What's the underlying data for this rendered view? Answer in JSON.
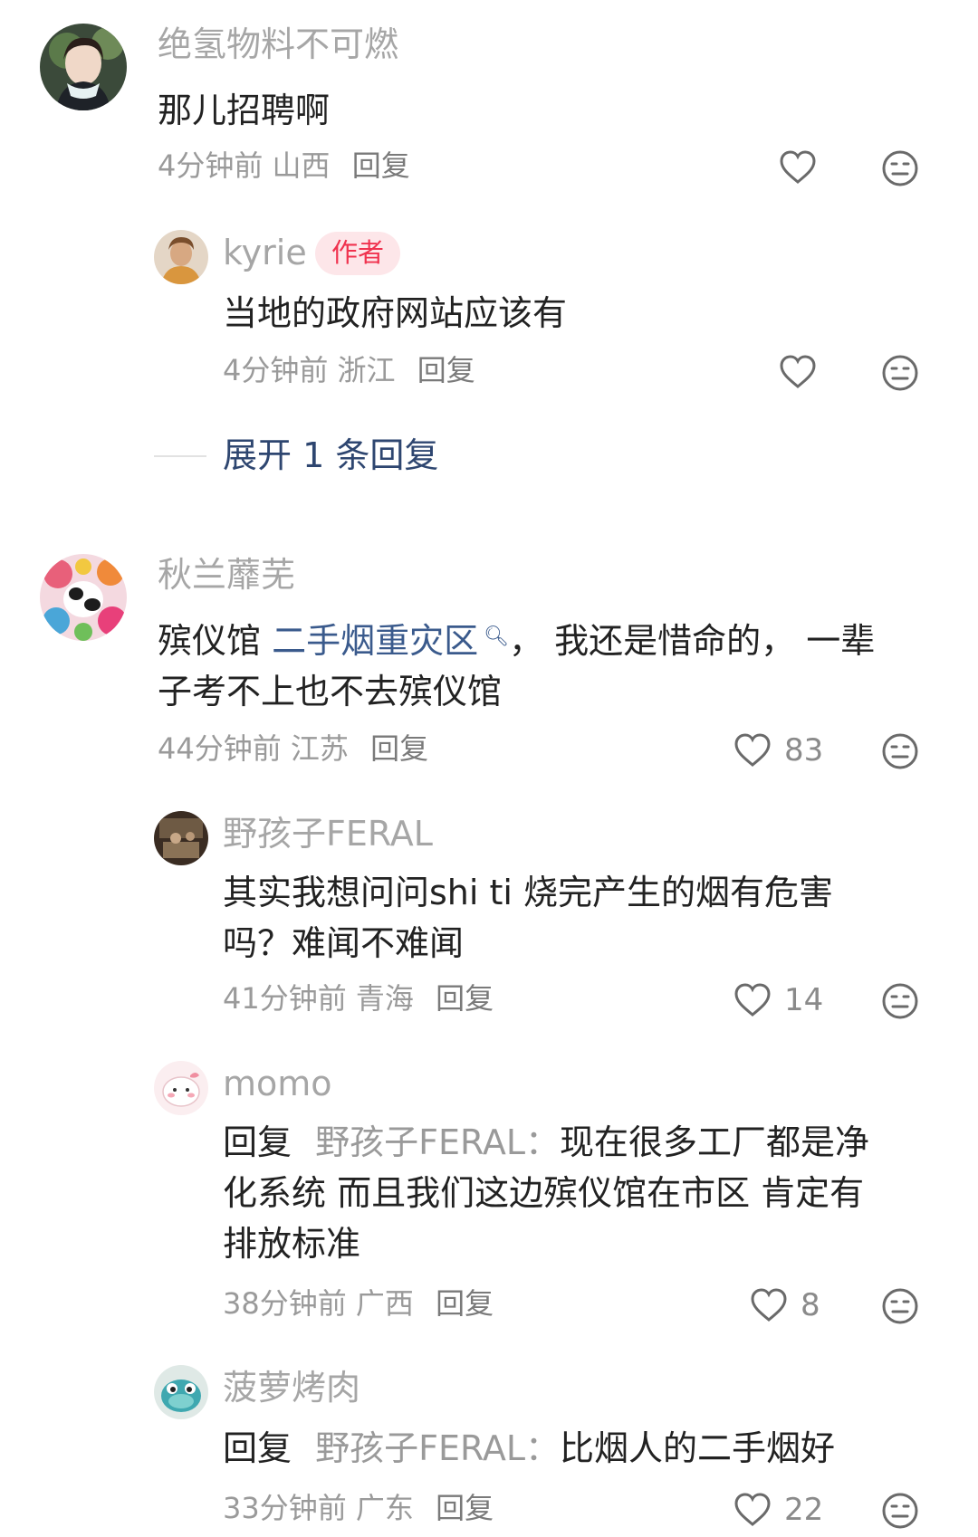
{
  "comments": [
    {
      "user": "绝氢物料不可燃",
      "text": "那儿招聘啊",
      "time": "4分钟前",
      "region": "山西",
      "reply_label": "回复",
      "likes": "",
      "replies": [
        {
          "user": "kyrie",
          "badge": "作者",
          "text": "当地的政府网站应该有",
          "time": "4分钟前",
          "region": "浙江",
          "reply_label": "回复",
          "likes": ""
        }
      ],
      "expand_label": "展开 1 条回复"
    },
    {
      "user": "秋兰蘼芜",
      "text_prefix": "殡仪馆 ",
      "link_text": "二手烟重灾区",
      "text_line1_suffix": "，  我还是惜命的，  一辈",
      "text_line2": "子考不上也不去殡仪馆",
      "time": "44分钟前",
      "region": "江苏",
      "reply_label": "回复",
      "likes": "83",
      "replies": [
        {
          "user": "野孩子FERAL",
          "text_line1": "其实我想问问shi ti 烧完产生的烟有危害",
          "text_line2": "吗？难闻不难闻",
          "time": "41分钟前",
          "region": "青海",
          "reply_label": "回复",
          "likes": "14"
        },
        {
          "user": "momo",
          "reply_prefix": "回复",
          "mention": "野孩子FERAL：",
          "text_line1": "现在很多工厂都是净",
          "text_line2": "化系统 而且我们这边殡仪馆在市区 肯定有",
          "text_line3": "排放标准",
          "time": "38分钟前",
          "region": "广西",
          "reply_label": "回复",
          "likes": "8"
        },
        {
          "user": "菠萝烤肉",
          "reply_prefix": "回复",
          "mention": "野孩子FERAL：",
          "text_line1": "比烟人的二手烟好",
          "time": "33分钟前",
          "region": "广东",
          "reply_label": "回复",
          "likes": "22"
        }
      ]
    }
  ],
  "icons": {
    "like": "heart-outline-icon",
    "dislike": "neutral-face-icon",
    "search": "search-icon"
  },
  "colors": {
    "author_badge_bg": "#fde6e9",
    "author_badge_text": "#f0324e",
    "link": "#3a5a8c",
    "expand": "#2e4670"
  }
}
